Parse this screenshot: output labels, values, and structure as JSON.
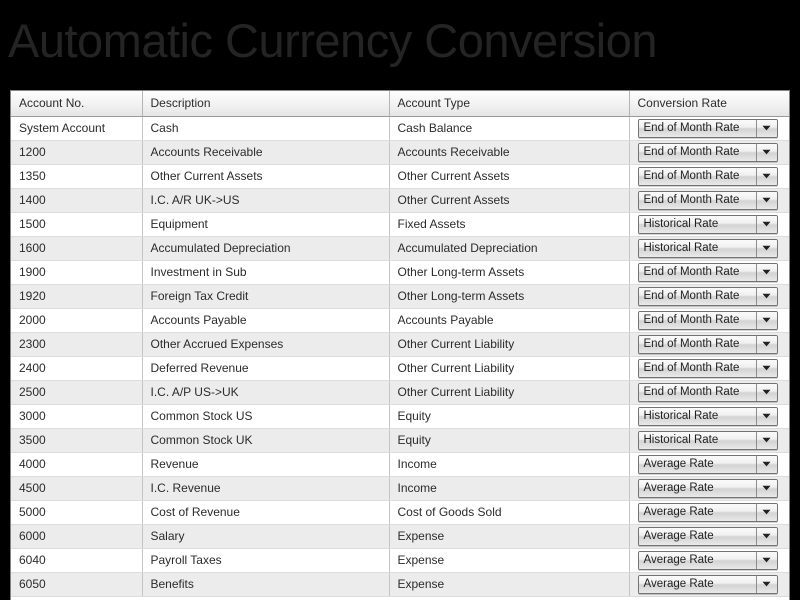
{
  "page": {
    "title": "Automatic Currency Conversion",
    "title_color": "#242424",
    "background_color": "#000000"
  },
  "table": {
    "columns": [
      {
        "key": "account_no",
        "label": "Account No."
      },
      {
        "key": "description",
        "label": "Description"
      },
      {
        "key": "account_type",
        "label": "Account Type"
      },
      {
        "key": "conversion_rate",
        "label": "Conversion Rate"
      }
    ],
    "dropdown_options": [
      "End of Month Rate",
      "Historical Rate",
      "Average Rate"
    ],
    "rows": [
      {
        "account_no": "System Account",
        "description": "Cash",
        "account_type": "Cash Balance",
        "conversion_rate": "End of Month Rate"
      },
      {
        "account_no": "1200",
        "description": "Accounts Receivable",
        "account_type": "Accounts Receivable",
        "conversion_rate": "End of Month Rate"
      },
      {
        "account_no": "1350",
        "description": "Other Current Assets",
        "account_type": "Other Current Assets",
        "conversion_rate": "End of Month Rate"
      },
      {
        "account_no": "1400",
        "description": "I.C. A/R UK->US",
        "account_type": "Other Current Assets",
        "conversion_rate": "End of Month Rate"
      },
      {
        "account_no": "1500",
        "description": "Equipment",
        "account_type": "Fixed Assets",
        "conversion_rate": "Historical Rate"
      },
      {
        "account_no": "1600",
        "description": "Accumulated Depreciation",
        "account_type": "Accumulated Depreciation",
        "conversion_rate": "Historical Rate"
      },
      {
        "account_no": "1900",
        "description": "Investment in Sub",
        "account_type": "Other Long-term Assets",
        "conversion_rate": "End of Month Rate"
      },
      {
        "account_no": "1920",
        "description": "Foreign Tax Credit",
        "account_type": "Other Long-term Assets",
        "conversion_rate": "End of Month Rate"
      },
      {
        "account_no": "2000",
        "description": "Accounts Payable",
        "account_type": "Accounts Payable",
        "conversion_rate": "End of Month Rate"
      },
      {
        "account_no": "2300",
        "description": "Other Accrued Expenses",
        "account_type": "Other Current Liability",
        "conversion_rate": "End of Month Rate"
      },
      {
        "account_no": "2400",
        "description": "Deferred Revenue",
        "account_type": "Other Current Liability",
        "conversion_rate": "End of Month Rate"
      },
      {
        "account_no": "2500",
        "description": "I.C. A/P US->UK",
        "account_type": "Other Current Liability",
        "conversion_rate": "End of Month Rate"
      },
      {
        "account_no": "3000",
        "description": "Common Stock US",
        "account_type": "Equity",
        "conversion_rate": "Historical Rate"
      },
      {
        "account_no": "3500",
        "description": "Common Stock UK",
        "account_type": "Equity",
        "conversion_rate": "Historical Rate"
      },
      {
        "account_no": "4000",
        "description": "Revenue",
        "account_type": "Income",
        "conversion_rate": "Average Rate"
      },
      {
        "account_no": "4500",
        "description": "I.C. Revenue",
        "account_type": "Income",
        "conversion_rate": "Average Rate"
      },
      {
        "account_no": "5000",
        "description": "Cost of Revenue",
        "account_type": "Cost of Goods Sold",
        "conversion_rate": "Average Rate"
      },
      {
        "account_no": "6000",
        "description": "Salary",
        "account_type": "Expense",
        "conversion_rate": "Average Rate"
      },
      {
        "account_no": "6040",
        "description": "Payroll Taxes",
        "account_type": "Expense",
        "conversion_rate": "Average Rate"
      },
      {
        "account_no": "6050",
        "description": "Benefits",
        "account_type": "Expense",
        "conversion_rate": "Average Rate"
      }
    ]
  }
}
